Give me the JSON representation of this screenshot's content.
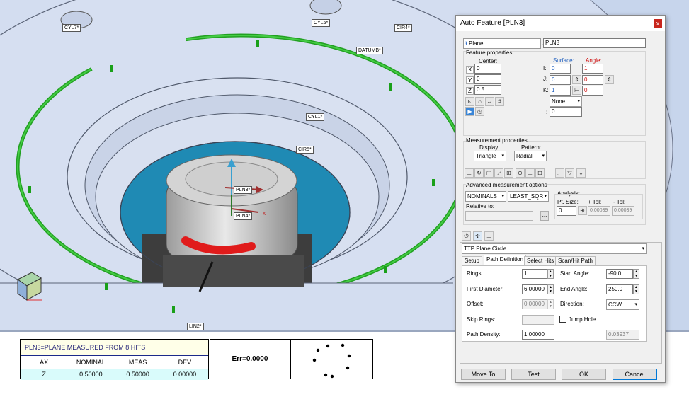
{
  "viewport": {
    "labels": {
      "cyl7": "CYL7*",
      "cyl6": "CYL6*",
      "cir4": "CIR4*",
      "datumb": "DATUMB*",
      "cyl1": "CYL1*",
      "cir5": "CIR5*",
      "pln3": "PLN3*",
      "pln4": "PLN4*",
      "lin2": "LIN2*"
    },
    "axis_x": "x"
  },
  "report": {
    "title": "PLN3=PLANE MEASURED FROM 8 HITS",
    "columns": [
      "AX",
      "NOMINAL",
      "MEAS",
      "DEV"
    ],
    "row": [
      "Z",
      "0.50000",
      "0.50000",
      "0.00000"
    ],
    "err": "Err=0.0000"
  },
  "dialog": {
    "title": "Auto Feature [PLN3]",
    "close": "x",
    "feature_type": "Plane",
    "feature_name": "PLN3",
    "feature_properties": {
      "label": "Feature properties",
      "center_label": "Center:",
      "x_label": "X",
      "x": "0",
      "y_label": "Y",
      "y": "0",
      "z_label": "Z",
      "z": "0.5",
      "surface_label": "Surface:",
      "angle_label": "Angle:",
      "i_label": "I:",
      "i_surface": "0",
      "i_angle": "1",
      "j_label": "J:",
      "j_surface": "0",
      "j_angle": "0",
      "k_label": "K:",
      "k_surface": "1",
      "k_angle": "0",
      "none_option": "None",
      "t_label": "T:",
      "t": "0"
    },
    "measurement_properties": {
      "label": "Measurement properties",
      "display_label": "Display:",
      "display": "Triangle",
      "pattern_label": "Pattern:",
      "pattern": "Radial"
    },
    "advanced": {
      "label": "Advanced measurement options",
      "nominals": "NOMINALS",
      "least_sqr": "LEAST_SQR",
      "relative_to": "Relative to:",
      "relative_value": "",
      "browse": "...",
      "analysis_label": "Analysis:",
      "pt_size_label": "Pt. Size:",
      "pt_size": "0",
      "plus_tol_label": "+ Tol:",
      "plus_tol": "0.00039",
      "minus_tol_label": "- Tol:",
      "minus_tol": "0.00039"
    },
    "strategy": "TTP Plane Circle",
    "tabs": [
      "Setup",
      "Path Definition",
      "Select Hits",
      "Scan/Hit Path"
    ],
    "path": {
      "rings_label": "Rings:",
      "rings": "1",
      "start_angle_label": "Start Angle:",
      "start_angle": "-90.0",
      "first_diameter_label": "First Diameter:",
      "first_diameter": "6.00000",
      "end_angle_label": "End Angle:",
      "end_angle": "250.0",
      "offset_label": "Offset:",
      "offset": "0.00000",
      "direction_label": "Direction:",
      "direction": "CCW",
      "skip_rings_label": "Skip Rings:",
      "skip_rings": "",
      "jump_hole_label": "Jump Hole",
      "path_density_label": "Path Density:",
      "path_density": "1.00000",
      "density_value": "0.03937"
    },
    "buttons": {
      "move_to": "Move To",
      "test": "Test",
      "ok": "OK",
      "cancel": "Cancel"
    }
  }
}
